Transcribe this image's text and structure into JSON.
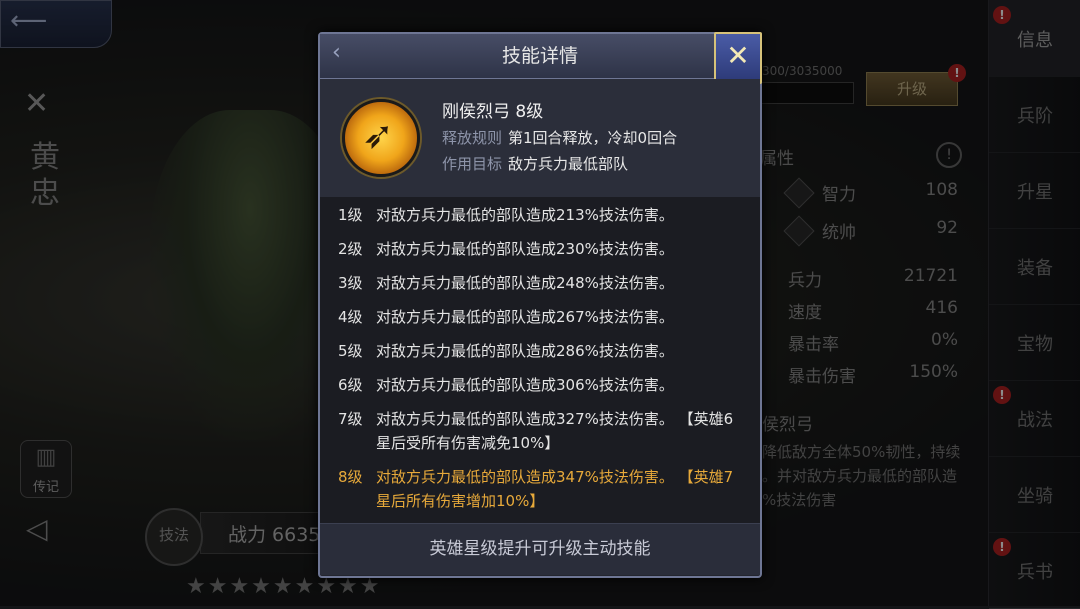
{
  "hero": {
    "name_chars": [
      "黄",
      "忠"
    ],
    "legend_label": "传记",
    "skill_seal": "技法",
    "power_text": "战力 6635",
    "stars": "★★★★★★★★★"
  },
  "side_panel": {
    "exp_text": "300/3035000",
    "upgrade_label": "升级",
    "attr_title": "属性",
    "info_glyph": "!",
    "stats": [
      {
        "label": "智力",
        "value": "108"
      },
      {
        "label": "统帅",
        "value": "92"
      },
      {
        "label": "兵力",
        "value": "21721"
      },
      {
        "label": "速度",
        "value": "416"
      },
      {
        "label": "暴击率",
        "value": "0%"
      },
      {
        "label": "暴击伤害",
        "value": "150%"
      }
    ],
    "skill_title": "侯烈弓",
    "skill_desc": "降低敌方全体50%韧性，持续 。并对敌方兵力最低的部队造 %技法伤害"
  },
  "nav": {
    "items": [
      {
        "label": "信息",
        "active": true,
        "dot": true
      },
      {
        "label": "兵阶",
        "active": false,
        "dot": false
      },
      {
        "label": "升星",
        "active": false,
        "dot": false
      },
      {
        "label": "装备",
        "active": false,
        "dot": false
      },
      {
        "label": "宝物",
        "active": false,
        "dot": false
      },
      {
        "label": "战法",
        "active": false,
        "dot": true
      },
      {
        "label": "坐骑",
        "active": false,
        "dot": false
      },
      {
        "label": "兵书",
        "active": false,
        "dot": true
      }
    ]
  },
  "dialog": {
    "title": "技能详情",
    "skill_name": "刚侯烈弓  8级",
    "rule_key": "释放规则",
    "rule_value": "第1回合释放，冷却0回合",
    "target_key": "作用目标",
    "target_value": "敌方兵力最低部队",
    "levels": [
      {
        "n": "1级",
        "text": "对敌方兵力最低的部队造成213%技法伤害。"
      },
      {
        "n": "2级",
        "text": "对敌方兵力最低的部队造成230%技法伤害。"
      },
      {
        "n": "3级",
        "text": "对敌方兵力最低的部队造成248%技法伤害。"
      },
      {
        "n": "4级",
        "text": "对敌方兵力最低的部队造成267%技法伤害。"
      },
      {
        "n": "5级",
        "text": "对敌方兵力最低的部队造成286%技法伤害。"
      },
      {
        "n": "6级",
        "text": "对敌方兵力最低的部队造成306%技法伤害。"
      },
      {
        "n": "7级",
        "text": "对敌方兵力最低的部队造成327%技法伤害。  【英雄6星后受所有伤害减免10%】"
      },
      {
        "n": "8级",
        "text": "对敌方兵力最低的部队造成347%技法伤害。  【英雄7星后所有伤害增加10%】"
      }
    ],
    "current_level_index": 7,
    "footer": "英雄星级提升可升级主动技能"
  },
  "colors": {
    "current_level": "#e7a93a",
    "close_border": "#d6c27a",
    "dialog_border": "#6e7694"
  },
  "icons": [
    "back-arrow-icon",
    "close-x-icon",
    "bow-skill-icon",
    "scroll-icon",
    "star-icon",
    "alert-dot-icon"
  ]
}
